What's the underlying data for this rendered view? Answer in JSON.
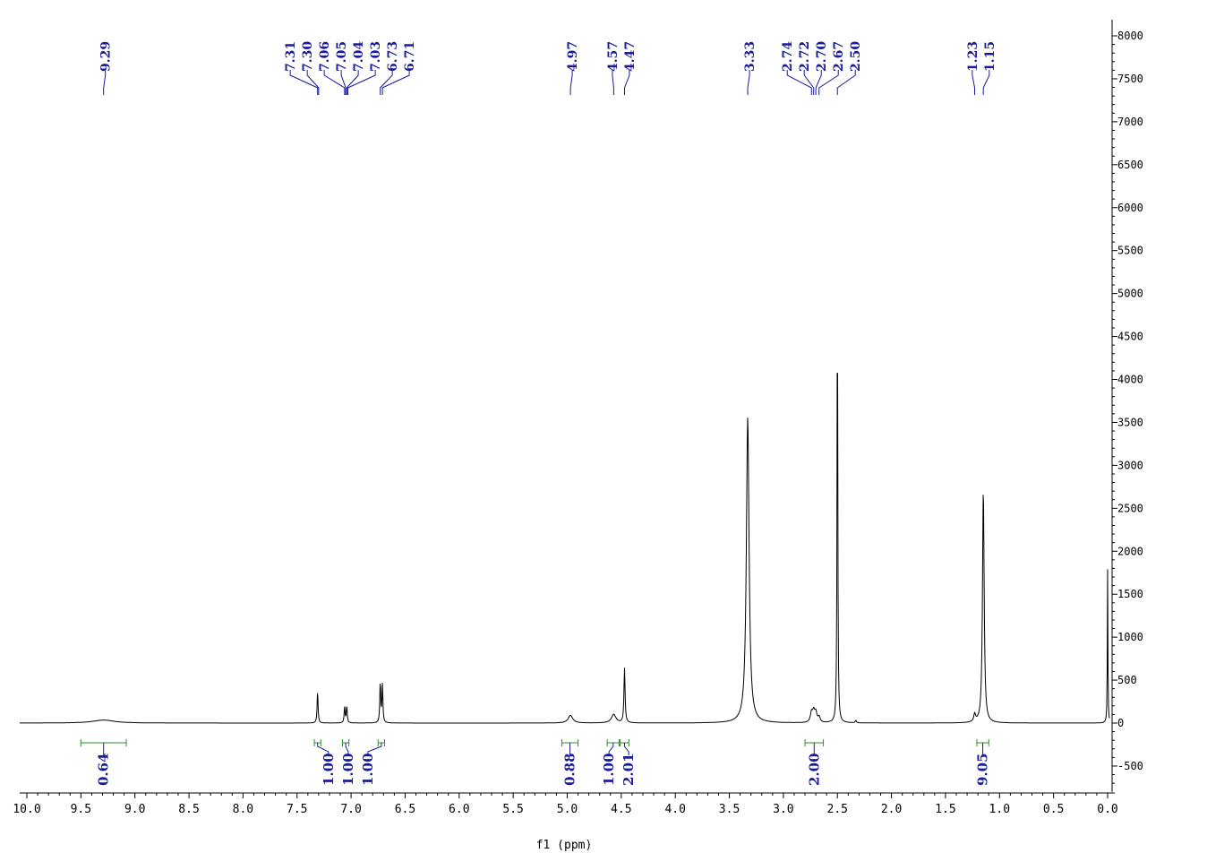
{
  "chart_data": {
    "type": "line",
    "title": "",
    "xlabel": "f1 (ppm)",
    "ylabel": "",
    "xlim": [
      10.2,
      -0.05
    ],
    "ylim": [
      -800,
      8250
    ],
    "x_reversed": true,
    "grid": false,
    "x_ticks": [
      "10.0",
      "9.5",
      "9.0",
      "8.5",
      "8.0",
      "7.5",
      "7.0",
      "6.5",
      "6.0",
      "5.5",
      "5.0",
      "4.5",
      "4.0",
      "3.5",
      "3.0",
      "2.5",
      "2.0",
      "1.5",
      "1.0",
      "0.5",
      "0.0"
    ],
    "y_ticks": [
      "8000",
      "7500",
      "7000",
      "6500",
      "6000",
      "5500",
      "5000",
      "4500",
      "4000",
      "3500",
      "3000",
      "2500",
      "2000",
      "1500",
      "1000",
      "500",
      "0",
      "-500"
    ],
    "series": [
      {
        "peaks": [
          {
            "ppm": 9.29,
            "height": 35,
            "width": 0.12
          },
          {
            "ppm": 7.31,
            "height": 380,
            "width": 0.005
          },
          {
            "ppm": 7.06,
            "height": 190,
            "width": 0.005
          },
          {
            "ppm": 7.04,
            "height": 200,
            "width": 0.005
          },
          {
            "ppm": 6.73,
            "height": 480,
            "width": 0.005
          },
          {
            "ppm": 6.71,
            "height": 450,
            "width": 0.005
          },
          {
            "ppm": 4.97,
            "height": 90,
            "width": 0.025
          },
          {
            "ppm": 4.57,
            "height": 100,
            "width": 0.025
          },
          {
            "ppm": 4.47,
            "height": 640,
            "width": 0.006
          },
          {
            "ppm": 3.33,
            "height": 3560,
            "width": 0.015
          },
          {
            "ppm": 2.74,
            "height": 110,
            "width": 0.012
          },
          {
            "ppm": 2.72,
            "height": 120,
            "width": 0.012
          },
          {
            "ppm": 2.7,
            "height": 110,
            "width": 0.012
          },
          {
            "ppm": 2.67,
            "height": 60,
            "width": 0.012
          },
          {
            "ppm": 2.5,
            "height": 5160,
            "width": 0.004
          },
          {
            "ppm": 2.33,
            "height": 30,
            "width": 0.006
          },
          {
            "ppm": 1.23,
            "height": 90,
            "width": 0.01
          },
          {
            "ppm": 1.15,
            "height": 2740,
            "width": 0.009
          },
          {
            "ppm": 0.0,
            "height": 1790,
            "width": 0.003
          }
        ]
      }
    ],
    "peak_labels": [
      {
        "group": [
          {
            "text": "9.29",
            "ppm": 9.29
          }
        ]
      },
      {
        "group": [
          {
            "text": "7.31",
            "ppm": 7.31
          },
          {
            "text": "7.30",
            "ppm": 7.3
          },
          {
            "text": "7.06",
            "ppm": 7.06
          },
          {
            "text": "7.05",
            "ppm": 7.05
          },
          {
            "text": "7.04",
            "ppm": 7.04
          },
          {
            "text": "7.03",
            "ppm": 7.03
          },
          {
            "text": "6.73",
            "ppm": 6.73
          },
          {
            "text": "6.71",
            "ppm": 6.71
          }
        ]
      },
      {
        "group": [
          {
            "text": "4.97",
            "ppm": 4.97
          }
        ]
      },
      {
        "group": [
          {
            "text": "4.57",
            "ppm": 4.57
          },
          {
            "text": "4.47",
            "ppm": 4.47
          }
        ]
      },
      {
        "group": [
          {
            "text": "3.33",
            "ppm": 3.33
          }
        ]
      },
      {
        "group": [
          {
            "text": "2.74",
            "ppm": 2.74
          },
          {
            "text": "2.72",
            "ppm": 2.72
          },
          {
            "text": "2.70",
            "ppm": 2.7
          },
          {
            "text": "2.67",
            "ppm": 2.67
          },
          {
            "text": "2.50",
            "ppm": 2.5
          }
        ]
      },
      {
        "group": [
          {
            "text": "1.23",
            "ppm": 1.23
          },
          {
            "text": "1.15",
            "ppm": 1.15
          }
        ]
      }
    ],
    "integrals": [
      {
        "from": 9.5,
        "to": 9.08,
        "value": "0.64"
      },
      {
        "from": 7.34,
        "to": 7.28,
        "value": "1.00"
      },
      {
        "from": 7.08,
        "to": 7.02,
        "value": "1.00"
      },
      {
        "from": 6.75,
        "to": 6.69,
        "value": "1.00"
      },
      {
        "from": 5.05,
        "to": 4.9,
        "value": "0.88"
      },
      {
        "from": 4.63,
        "to": 4.52,
        "value": "1.00"
      },
      {
        "from": 4.51,
        "to": 4.43,
        "value": "2.01"
      },
      {
        "from": 2.8,
        "to": 2.63,
        "value": "2.00"
      },
      {
        "from": 1.21,
        "to": 1.1,
        "value": "9.05"
      }
    ],
    "colors": {
      "spectrum": "#000000",
      "peak_label": "#1a1a9a",
      "integral": "#2e8b2e",
      "integral_label": "#1a1a9a"
    }
  }
}
